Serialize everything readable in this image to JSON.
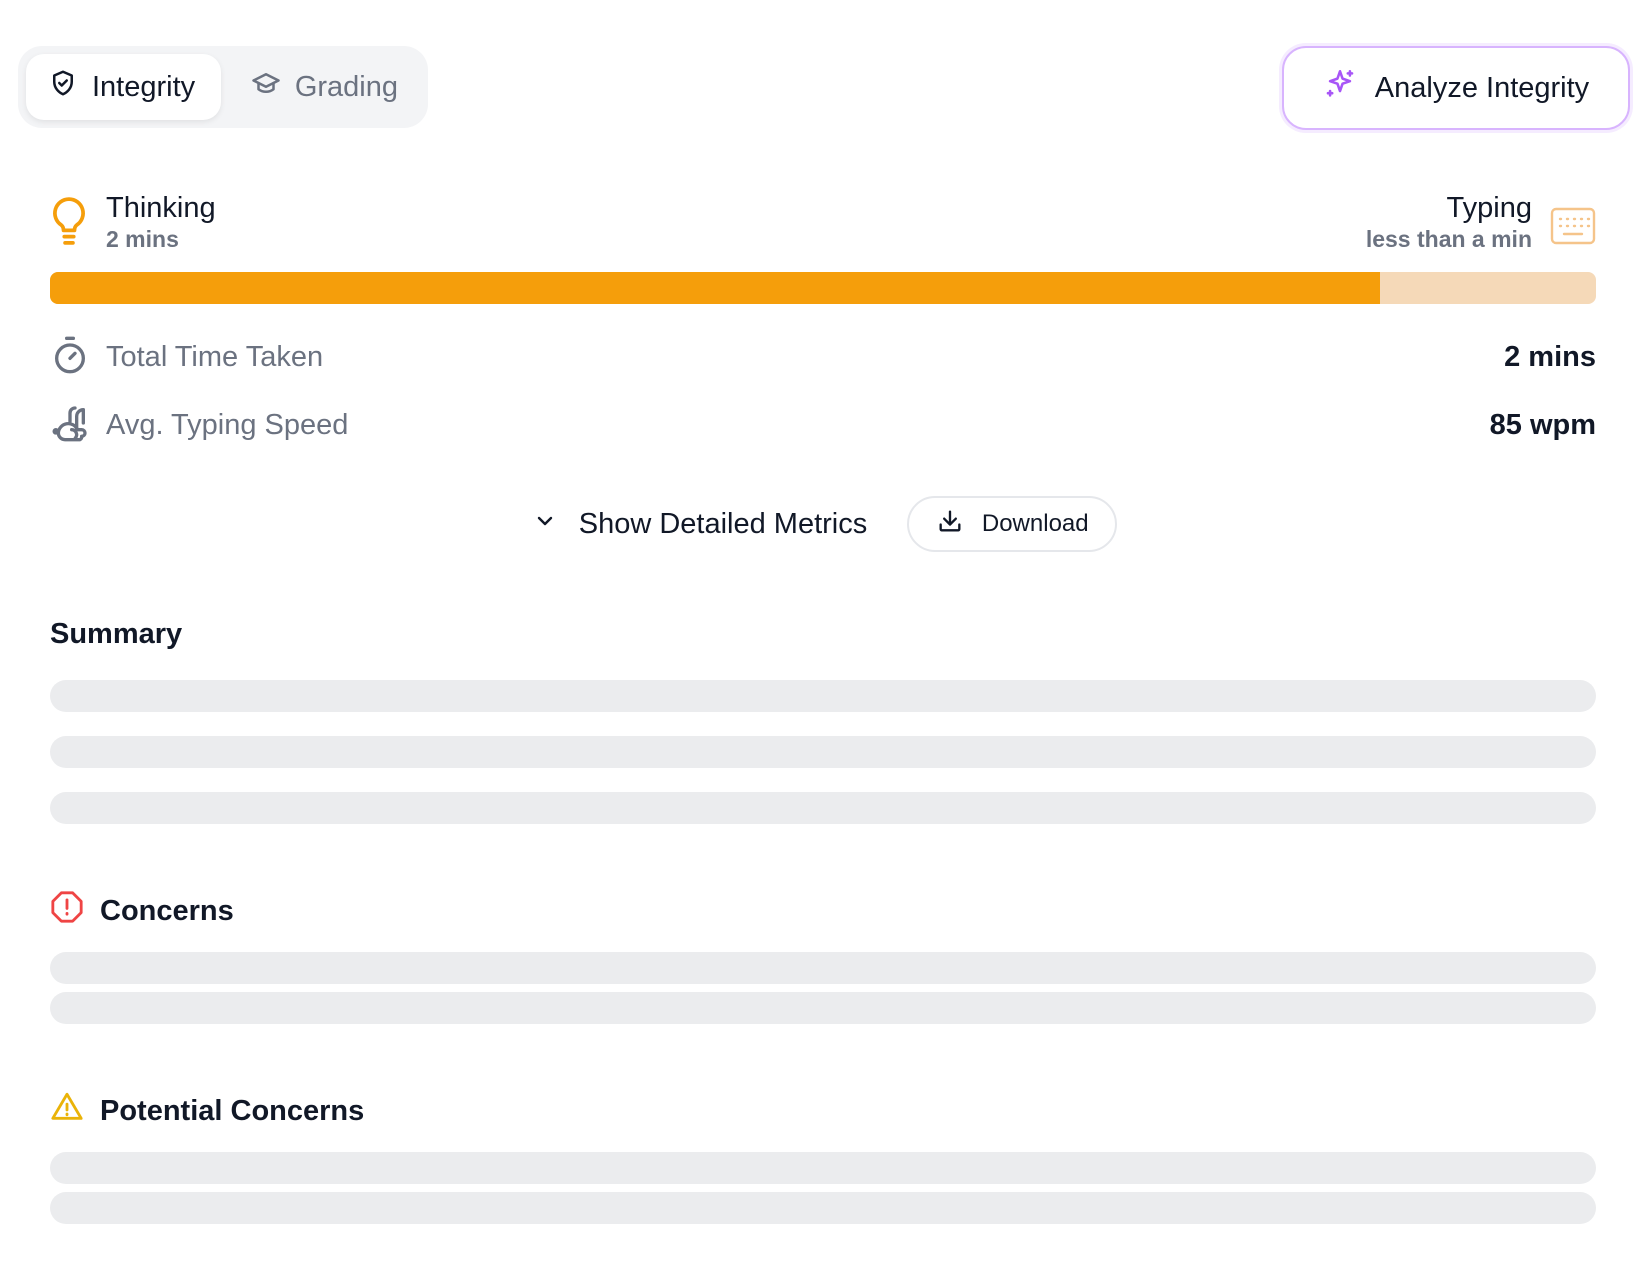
{
  "tabs": [
    {
      "label": "Integrity",
      "icon": "shield-check-icon",
      "active": true
    },
    {
      "label": "Grading",
      "icon": "graduation-cap-icon",
      "active": false
    }
  ],
  "analyze_button": {
    "label": "Analyze Integrity",
    "icon": "sparkles-icon"
  },
  "thinking": {
    "label": "Thinking",
    "value": "2 mins",
    "icon": "lightbulb-icon"
  },
  "typing": {
    "label": "Typing",
    "value": "less than a min",
    "icon": "keyboard-icon"
  },
  "time_split": {
    "thinking_fraction": 0.86
  },
  "metrics": [
    {
      "label": "Total Time Taken",
      "value": "2 mins",
      "icon": "timer-icon"
    },
    {
      "label": "Avg. Typing Speed",
      "value": "85 wpm",
      "icon": "rabbit-icon"
    }
  ],
  "actions": {
    "show_detailed": "Show Detailed Metrics",
    "download": "Download"
  },
  "sections": {
    "summary": "Summary",
    "concerns": "Concerns",
    "potential_concerns": "Potential Concerns"
  },
  "colors": {
    "accent_orange": "#f59e0b",
    "bar_track": "#f5d9b8",
    "concern_red": "#ef4444",
    "warning_yellow": "#eab308",
    "analyze_purple": "#a855f7"
  }
}
